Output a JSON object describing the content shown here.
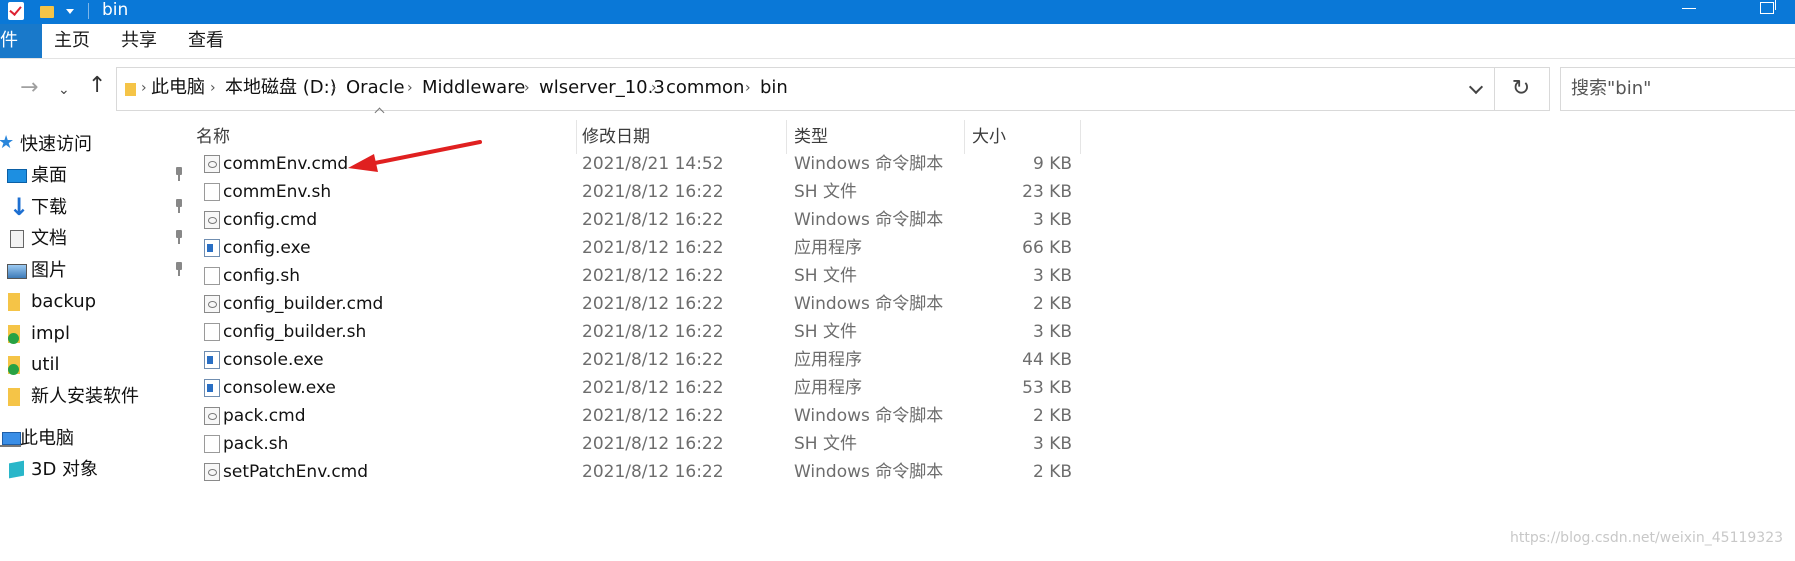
{
  "window": {
    "title": "bin"
  },
  "ribbon": {
    "file_tab": "文件",
    "tabs": [
      "主页",
      "共享",
      "查看"
    ]
  },
  "address": {
    "breadcrumbs": [
      "此电脑",
      "本地磁盘 (D:)",
      "Oracle",
      "Middleware",
      "wlserver_10.3",
      "common",
      "bin"
    ]
  },
  "search": {
    "placeholder": "搜索\"bin\""
  },
  "sidebar": {
    "items": [
      {
        "label": "快速访问",
        "icon": "star-icon"
      },
      {
        "label": "桌面",
        "icon": "desktop-icon",
        "pinned": true
      },
      {
        "label": "下载",
        "icon": "download-icon",
        "pinned": true
      },
      {
        "label": "文档",
        "icon": "document-icon",
        "pinned": true
      },
      {
        "label": "图片",
        "icon": "pictures-icon",
        "pinned": true
      },
      {
        "label": "backup",
        "icon": "folder-icon"
      },
      {
        "label": "impl",
        "icon": "folder-check-icon"
      },
      {
        "label": "util",
        "icon": "folder-check-icon"
      },
      {
        "label": "新人安装软件",
        "icon": "folder-icon"
      },
      {
        "label": "此电脑",
        "icon": "this-pc-icon"
      },
      {
        "label": "3D 对象",
        "icon": "3d-objects-icon"
      }
    ]
  },
  "columns": {
    "name": "名称",
    "date": "修改日期",
    "type": "类型",
    "size": "大小"
  },
  "files": [
    {
      "name": "commEnv.cmd",
      "date": "2021/8/21 14:52",
      "type": "Windows 命令脚本",
      "size": "9 KB",
      "kind": "cmd"
    },
    {
      "name": "commEnv.sh",
      "date": "2021/8/12 16:22",
      "type": "SH 文件",
      "size": "23 KB",
      "kind": "sh"
    },
    {
      "name": "config.cmd",
      "date": "2021/8/12 16:22",
      "type": "Windows 命令脚本",
      "size": "3 KB",
      "kind": "cmd"
    },
    {
      "name": "config.exe",
      "date": "2021/8/12 16:22",
      "type": "应用程序",
      "size": "66 KB",
      "kind": "exe"
    },
    {
      "name": "config.sh",
      "date": "2021/8/12 16:22",
      "type": "SH 文件",
      "size": "3 KB",
      "kind": "sh"
    },
    {
      "name": "config_builder.cmd",
      "date": "2021/8/12 16:22",
      "type": "Windows 命令脚本",
      "size": "2 KB",
      "kind": "cmd"
    },
    {
      "name": "config_builder.sh",
      "date": "2021/8/12 16:22",
      "type": "SH 文件",
      "size": "3 KB",
      "kind": "sh"
    },
    {
      "name": "console.exe",
      "date": "2021/8/12 16:22",
      "type": "应用程序",
      "size": "44 KB",
      "kind": "exe"
    },
    {
      "name": "consolew.exe",
      "date": "2021/8/12 16:22",
      "type": "应用程序",
      "size": "53 KB",
      "kind": "exe"
    },
    {
      "name": "pack.cmd",
      "date": "2021/8/12 16:22",
      "type": "Windows 命令脚本",
      "size": "2 KB",
      "kind": "cmd"
    },
    {
      "name": "pack.sh",
      "date": "2021/8/12 16:22",
      "type": "SH 文件",
      "size": "3 KB",
      "kind": "sh"
    },
    {
      "name": "setPatchEnv.cmd",
      "date": "2021/8/12 16:22",
      "type": "Windows 命令脚本",
      "size": "2 KB",
      "kind": "cmd"
    }
  ],
  "colors": {
    "titlebar": "#0a78d7",
    "file_tab": "#1979ca",
    "annotation_arrow": "#e02020"
  },
  "watermark": "https://blog.csdn.net/weixin_45119323"
}
